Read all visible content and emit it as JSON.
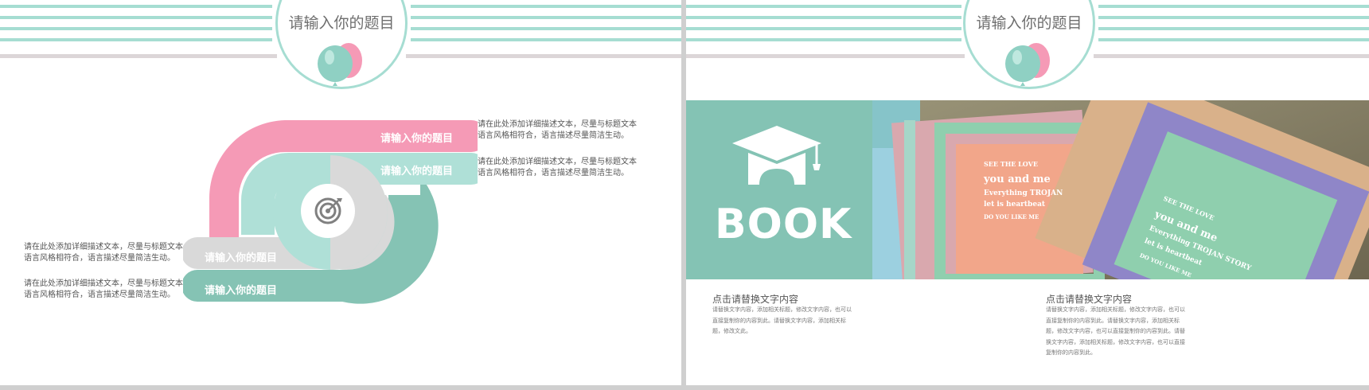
{
  "left_slide": {
    "title": "请输入你的题目",
    "items": [
      {
        "label": "请输入你的题目",
        "color": "#f59ab6"
      },
      {
        "label": "请输入你的题目",
        "color": "#afe0d7"
      },
      {
        "label": "请输入你的题目",
        "color": "#d9d9d9"
      },
      {
        "label": "请输入你的题目",
        "color": "#85c3b4"
      }
    ],
    "descriptions": [
      "请在此处添加详细描述文本，尽量与标题文本语言风格相符合，语言描述尽量简洁生动。",
      "请在此处添加详细描述文本，尽量与标题文本语言风格相符合，语言描述尽量简洁生动。",
      "请在此处添加详细描述文本，尽量与标题文本语言风格相符合，语言描述尽量简洁生动。",
      "请在此处添加详细描述文本，尽量与标题文本语言风格相符合，语言描述尽量简洁生动。"
    ],
    "center_icon": "target-icon"
  },
  "right_slide": {
    "title": "请输入你的题目",
    "book_word": "BOOK",
    "panel_icon": "graduation-cap-icon",
    "photo_texts": {
      "see_love": "SEE THE LOVE",
      "you_and_me": "you and me",
      "everything": "Everything TROJAN",
      "heartbeat": "let is heartbeat",
      "do_you": "DO YOU LIKE ME",
      "see_love_2": "SEE THE LOVE",
      "you_and_me_2": "you and me",
      "everything_2": "Everything TROJAN STORY",
      "heartbeat_2": "let is heartbeat",
      "do_you_2": "DO YOU LIKE ME"
    },
    "captions": [
      {
        "title": "点击请替换文字内容",
        "body": "请替换文字内容，添加相关标题，修改文字内容，也可以直接复制你的内容到此。请替换文字内容，添加相关标题，修改文此。"
      },
      {
        "title": "点击请替换文字内容",
        "body": "请替换文字内容，添加相关标题，修改文字内容，也可以直接复制你的内容到此。请替换文字内容，添加相关标题，修改文字内容，也可以直接复制你的内容到此。请替换文字内容，添加相关标题，修改文字内容，也可以直接复制你的内容到此。"
      }
    ]
  },
  "colors": {
    "mint": "#a6ddd2",
    "teal": "#84c3b4",
    "pink": "#f59ab6",
    "gray": "#d9d9d9"
  }
}
